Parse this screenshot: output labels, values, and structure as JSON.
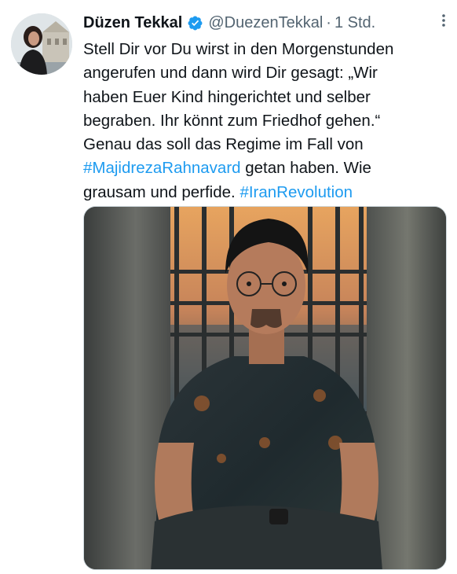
{
  "author": {
    "name": "Düzen Tekkal",
    "handle": "@DuezenTekkal",
    "separator": "·",
    "time": "1 Std."
  },
  "tweet": {
    "line1": "Stell Dir vor Du wirst in den Morgenstunden",
    "line2": "angerufen und dann wird Dir gesagt: „Wir",
    "line3": "haben Euer Kind hingerichtet und selber",
    "line4": "begraben. Ihr könnt zum Friedhof gehen.“",
    "line5": "Genau das soll das Regime im Fall von",
    "hashtag1": "#MajidrezaRahnavard",
    "line6_rest": " getan haben. Wie",
    "line7_start": "grausam und perfide. ",
    "hashtag2": "#IranRevolution"
  },
  "icons": {
    "verified": "verified-badge-icon",
    "more": "more-options-icon"
  },
  "colors": {
    "link": "#1d9bf0",
    "verified": "#1d9bf0",
    "muted": "#536471"
  }
}
